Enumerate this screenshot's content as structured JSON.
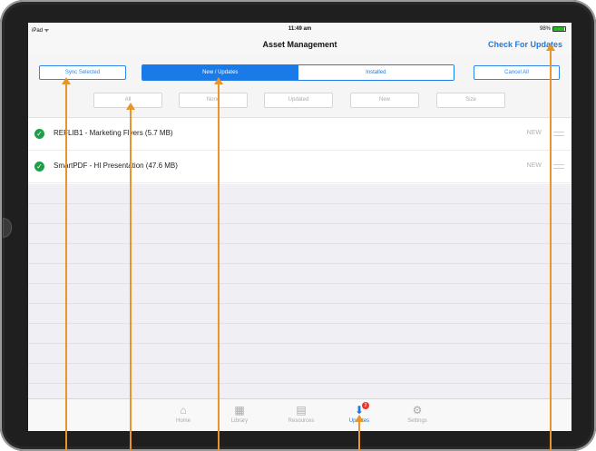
{
  "status_bar": {
    "carrier": "iPad ᯤ",
    "time": "11:49 am",
    "battery": "98%"
  },
  "nav": {
    "title": "Asset Management",
    "check_updates": "Check For Updates"
  },
  "toolbar": {
    "sync_selected": "Sync Selected",
    "cancel_all": "Cancel All",
    "segments": [
      "New / Updates",
      "Installed"
    ],
    "active_segment": "New / Updates"
  },
  "filters": [
    "All",
    "None",
    "Updated",
    "New",
    "Size"
  ],
  "assets": [
    {
      "name": "REFLIB1 - Marketing Flyers (5.7 MB)",
      "status": "NEW"
    },
    {
      "name": "SmartPDF - HI Presentation (47.6 MB)",
      "status": "NEW"
    }
  ],
  "tabs": [
    {
      "label": "Home",
      "icon": "home-icon"
    },
    {
      "label": "Library",
      "icon": "grid-icon"
    },
    {
      "label": "Resources",
      "icon": "cabinet-icon"
    },
    {
      "label": "Updates",
      "icon": "download-icon",
      "badge": "2"
    },
    {
      "label": "Settings",
      "icon": "gear-icon"
    }
  ],
  "active_tab": "Updates",
  "colors": {
    "accent": "#1a7be8",
    "badge": "#e8362c",
    "check": "#1f9e4a",
    "annotation": "#e8962a"
  }
}
